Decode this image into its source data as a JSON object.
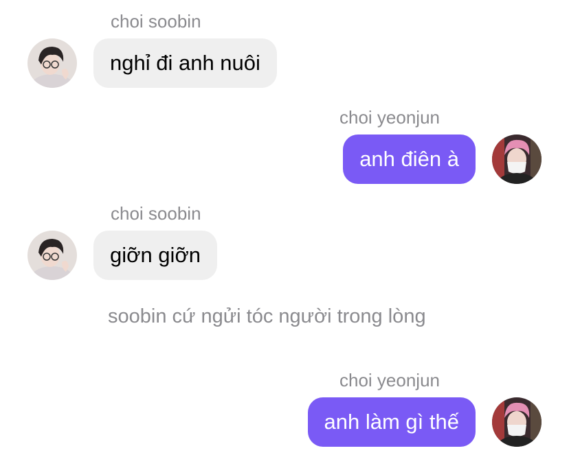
{
  "colors": {
    "incoming_bubble": "#efefef",
    "outgoing_bubble": "#7a5af5",
    "name_text": "#8a8a8e"
  },
  "messages": [
    {
      "sender": "choi soobin",
      "text": "nghỉ đi anh nuôi",
      "direction": "incoming",
      "avatar_icon": "soobin-avatar"
    },
    {
      "sender": "choi yeonjun",
      "text": "anh điên à",
      "direction": "outgoing",
      "avatar_icon": "yeonjun-avatar"
    },
    {
      "sender": "choi soobin",
      "text": "giỡn giỡn",
      "direction": "incoming",
      "avatar_icon": "soobin-avatar"
    },
    {
      "narration": "soobin cứ ngửi tóc người trong lòng"
    },
    {
      "sender": "choi yeonjun",
      "text": "anh làm gì thế",
      "direction": "outgoing",
      "avatar_icon": "yeonjun-avatar"
    }
  ]
}
